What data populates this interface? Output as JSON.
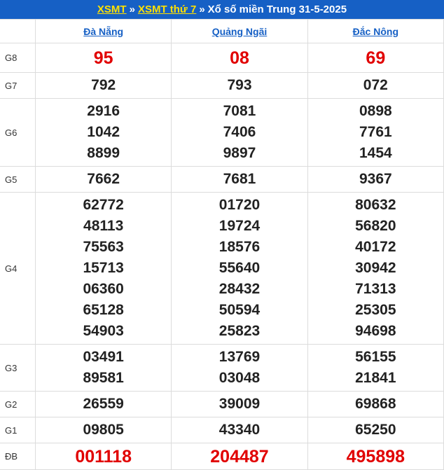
{
  "header": {
    "link1": "XSMT",
    "sep1": "»",
    "link2": "XSMT thứ 7",
    "sep2": "»",
    "title": "Xổ số miền Trung 31-5-2025"
  },
  "provinces": [
    "Đà Nẵng",
    "Quảng Ngãi",
    "Đắc Nông"
  ],
  "rows": {
    "g8": {
      "label": "G8",
      "values": [
        [
          "95"
        ],
        [
          "08"
        ],
        [
          "69"
        ]
      ]
    },
    "g7": {
      "label": "G7",
      "values": [
        [
          "792"
        ],
        [
          "793"
        ],
        [
          "072"
        ]
      ]
    },
    "g6": {
      "label": "G6",
      "values": [
        [
          "2916",
          "1042",
          "8899"
        ],
        [
          "7081",
          "7406",
          "9897"
        ],
        [
          "0898",
          "7761",
          "1454"
        ]
      ]
    },
    "g5": {
      "label": "G5",
      "values": [
        [
          "7662"
        ],
        [
          "7681"
        ],
        [
          "9367"
        ]
      ]
    },
    "g4": {
      "label": "G4",
      "values": [
        [
          "62772",
          "48113",
          "75563",
          "15713",
          "06360",
          "65128",
          "54903"
        ],
        [
          "01720",
          "19724",
          "18576",
          "55640",
          "28432",
          "50594",
          "25823"
        ],
        [
          "80632",
          "56820",
          "40172",
          "30942",
          "71313",
          "25305",
          "94698"
        ]
      ]
    },
    "g3": {
      "label": "G3",
      "values": [
        [
          "03491",
          "89581"
        ],
        [
          "13769",
          "03048"
        ],
        [
          "56155",
          "21841"
        ]
      ]
    },
    "g2": {
      "label": "G2",
      "values": [
        [
          "26559"
        ],
        [
          "39009"
        ],
        [
          "69868"
        ]
      ]
    },
    "g1": {
      "label": "G1",
      "values": [
        [
          "09805"
        ],
        [
          "43340"
        ],
        [
          "65250"
        ]
      ]
    },
    "db": {
      "label": "ĐB",
      "values": [
        [
          "001118"
        ],
        [
          "204487"
        ],
        [
          "495898"
        ]
      ]
    }
  },
  "colors": {
    "header_bg": "#1660c5",
    "link_yellow": "#ffe000",
    "red": "#e10000"
  }
}
